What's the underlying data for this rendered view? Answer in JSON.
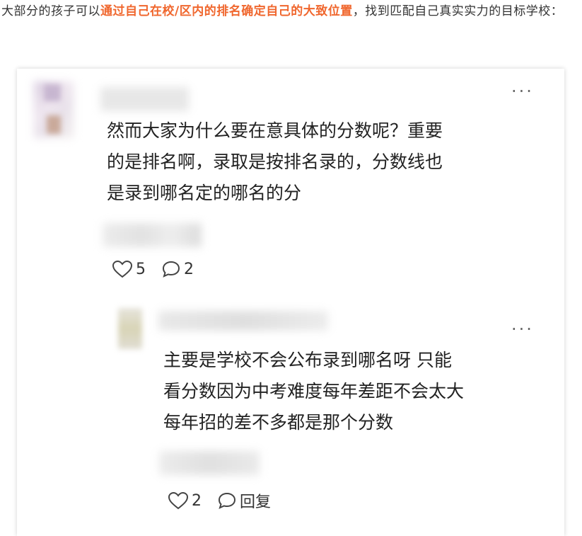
{
  "intro": {
    "prefix": "大部分的孩子可以",
    "highlight": "通过自己在校/区内的排名确定自己的大致位置",
    "suffix": "，找到匹配自己真实实力的目标学校："
  },
  "comment": {
    "text_lines": [
      "然而大家为什么要在意具体的分数呢？重要",
      "的是排名啊，录取是按排名录的，分数线也",
      "是录到哪名定的哪名的分"
    ],
    "likes": "5",
    "replies": "2",
    "more": "···"
  },
  "reply": {
    "text_lines": [
      "主要是学校不会公布录到哪名呀 只能",
      "看分数因为中考难度每年差距不会太大",
      "每年招的差不多都是那个分数"
    ],
    "likes": "2",
    "reply_label": "回复",
    "more": "···"
  },
  "colors": {
    "accent": "#f0672e"
  }
}
